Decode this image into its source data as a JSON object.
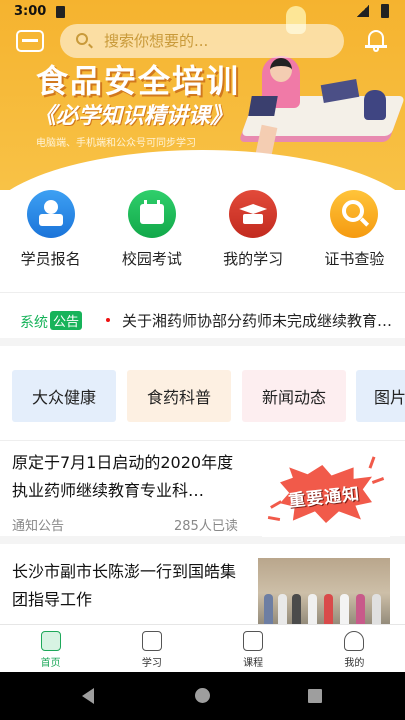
{
  "status_bar": {
    "time": "3:00"
  },
  "header": {
    "search_placeholder": "搜索你想要的..."
  },
  "banner": {
    "title": "食品安全培训",
    "subtitle": "《必学知识精讲课》",
    "note": "电脑端、手机端和公众号可同步学习",
    "dots_total": 4,
    "dots_active_index": 3
  },
  "quick_menu": [
    {
      "label": "学员报名",
      "icon": "student-book-icon",
      "color": "#1b74d9"
    },
    {
      "label": "校园考试",
      "icon": "calendar-check-icon",
      "color": "#12a84a"
    },
    {
      "label": "我的学习",
      "icon": "graduation-cap-icon",
      "color": "#c22a1f"
    },
    {
      "label": "证书查验",
      "icon": "magnifier-icon",
      "color": "#f59a10"
    }
  ],
  "notice": {
    "label_prefix": "系统",
    "label_badge": "公告",
    "text": "关于湘药师协部分药师未完成继续教育…"
  },
  "categories": [
    {
      "label": "大众健康",
      "bg": "#e4eefb"
    },
    {
      "label": "食药科普",
      "bg": "#fdf0e2"
    },
    {
      "label": "新闻动态",
      "bg": "#fdeef0"
    },
    {
      "label": "图片",
      "bg": "#e4eefb"
    }
  ],
  "articles": [
    {
      "title": "原定于7月1日启动的2020年度执业药师继续教育专业科…",
      "category": "通知公告",
      "reads": "285人已读",
      "thumb_text": "重要通知"
    },
    {
      "title": "长沙市副市长陈澎一行到国皓集团指导工作"
    }
  ],
  "tabbar": [
    {
      "label": "首页",
      "icon": "home-icon",
      "active": true
    },
    {
      "label": "学习",
      "icon": "book-icon",
      "active": false
    },
    {
      "label": "课程",
      "icon": "open-book-icon",
      "active": false
    },
    {
      "label": "我的",
      "icon": "user-icon",
      "active": false
    }
  ],
  "colors": {
    "brand_green": "#1ea85a",
    "banner_orange": "#f5b32f"
  }
}
